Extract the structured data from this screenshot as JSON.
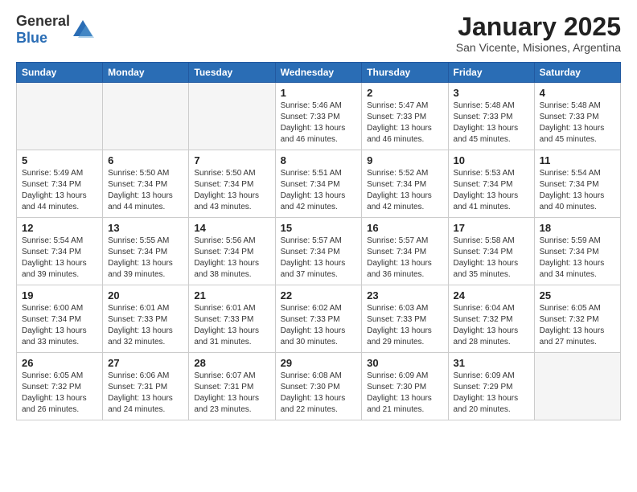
{
  "header": {
    "logo_general": "General",
    "logo_blue": "Blue",
    "month": "January 2025",
    "location": "San Vicente, Misiones, Argentina"
  },
  "days_of_week": [
    "Sunday",
    "Monday",
    "Tuesday",
    "Wednesday",
    "Thursday",
    "Friday",
    "Saturday"
  ],
  "weeks": [
    [
      {
        "day": "",
        "info": ""
      },
      {
        "day": "",
        "info": ""
      },
      {
        "day": "",
        "info": ""
      },
      {
        "day": "1",
        "info": "Sunrise: 5:46 AM\nSunset: 7:33 PM\nDaylight: 13 hours\nand 46 minutes."
      },
      {
        "day": "2",
        "info": "Sunrise: 5:47 AM\nSunset: 7:33 PM\nDaylight: 13 hours\nand 46 minutes."
      },
      {
        "day": "3",
        "info": "Sunrise: 5:48 AM\nSunset: 7:33 PM\nDaylight: 13 hours\nand 45 minutes."
      },
      {
        "day": "4",
        "info": "Sunrise: 5:48 AM\nSunset: 7:33 PM\nDaylight: 13 hours\nand 45 minutes."
      }
    ],
    [
      {
        "day": "5",
        "info": "Sunrise: 5:49 AM\nSunset: 7:34 PM\nDaylight: 13 hours\nand 44 minutes."
      },
      {
        "day": "6",
        "info": "Sunrise: 5:50 AM\nSunset: 7:34 PM\nDaylight: 13 hours\nand 44 minutes."
      },
      {
        "day": "7",
        "info": "Sunrise: 5:50 AM\nSunset: 7:34 PM\nDaylight: 13 hours\nand 43 minutes."
      },
      {
        "day": "8",
        "info": "Sunrise: 5:51 AM\nSunset: 7:34 PM\nDaylight: 13 hours\nand 42 minutes."
      },
      {
        "day": "9",
        "info": "Sunrise: 5:52 AM\nSunset: 7:34 PM\nDaylight: 13 hours\nand 42 minutes."
      },
      {
        "day": "10",
        "info": "Sunrise: 5:53 AM\nSunset: 7:34 PM\nDaylight: 13 hours\nand 41 minutes."
      },
      {
        "day": "11",
        "info": "Sunrise: 5:54 AM\nSunset: 7:34 PM\nDaylight: 13 hours\nand 40 minutes."
      }
    ],
    [
      {
        "day": "12",
        "info": "Sunrise: 5:54 AM\nSunset: 7:34 PM\nDaylight: 13 hours\nand 39 minutes."
      },
      {
        "day": "13",
        "info": "Sunrise: 5:55 AM\nSunset: 7:34 PM\nDaylight: 13 hours\nand 39 minutes."
      },
      {
        "day": "14",
        "info": "Sunrise: 5:56 AM\nSunset: 7:34 PM\nDaylight: 13 hours\nand 38 minutes."
      },
      {
        "day": "15",
        "info": "Sunrise: 5:57 AM\nSunset: 7:34 PM\nDaylight: 13 hours\nand 37 minutes."
      },
      {
        "day": "16",
        "info": "Sunrise: 5:57 AM\nSunset: 7:34 PM\nDaylight: 13 hours\nand 36 minutes."
      },
      {
        "day": "17",
        "info": "Sunrise: 5:58 AM\nSunset: 7:34 PM\nDaylight: 13 hours\nand 35 minutes."
      },
      {
        "day": "18",
        "info": "Sunrise: 5:59 AM\nSunset: 7:34 PM\nDaylight: 13 hours\nand 34 minutes."
      }
    ],
    [
      {
        "day": "19",
        "info": "Sunrise: 6:00 AM\nSunset: 7:34 PM\nDaylight: 13 hours\nand 33 minutes."
      },
      {
        "day": "20",
        "info": "Sunrise: 6:01 AM\nSunset: 7:33 PM\nDaylight: 13 hours\nand 32 minutes."
      },
      {
        "day": "21",
        "info": "Sunrise: 6:01 AM\nSunset: 7:33 PM\nDaylight: 13 hours\nand 31 minutes."
      },
      {
        "day": "22",
        "info": "Sunrise: 6:02 AM\nSunset: 7:33 PM\nDaylight: 13 hours\nand 30 minutes."
      },
      {
        "day": "23",
        "info": "Sunrise: 6:03 AM\nSunset: 7:33 PM\nDaylight: 13 hours\nand 29 minutes."
      },
      {
        "day": "24",
        "info": "Sunrise: 6:04 AM\nSunset: 7:32 PM\nDaylight: 13 hours\nand 28 minutes."
      },
      {
        "day": "25",
        "info": "Sunrise: 6:05 AM\nSunset: 7:32 PM\nDaylight: 13 hours\nand 27 minutes."
      }
    ],
    [
      {
        "day": "26",
        "info": "Sunrise: 6:05 AM\nSunset: 7:32 PM\nDaylight: 13 hours\nand 26 minutes."
      },
      {
        "day": "27",
        "info": "Sunrise: 6:06 AM\nSunset: 7:31 PM\nDaylight: 13 hours\nand 24 minutes."
      },
      {
        "day": "28",
        "info": "Sunrise: 6:07 AM\nSunset: 7:31 PM\nDaylight: 13 hours\nand 23 minutes."
      },
      {
        "day": "29",
        "info": "Sunrise: 6:08 AM\nSunset: 7:30 PM\nDaylight: 13 hours\nand 22 minutes."
      },
      {
        "day": "30",
        "info": "Sunrise: 6:09 AM\nSunset: 7:30 PM\nDaylight: 13 hours\nand 21 minutes."
      },
      {
        "day": "31",
        "info": "Sunrise: 6:09 AM\nSunset: 7:29 PM\nDaylight: 13 hours\nand 20 minutes."
      },
      {
        "day": "",
        "info": ""
      }
    ]
  ]
}
